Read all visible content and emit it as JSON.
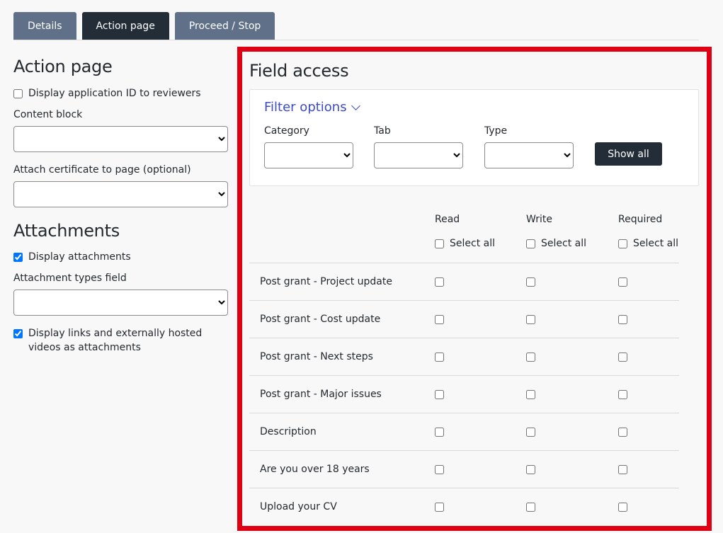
{
  "tabs": [
    {
      "label": "Details",
      "active": false
    },
    {
      "label": "Action page",
      "active": true
    },
    {
      "label": "Proceed / Stop",
      "active": false
    }
  ],
  "action_page": {
    "title": "Action page",
    "display_app_id": {
      "label": "Display application ID to reviewers",
      "checked": false
    },
    "content_block_label": "Content block",
    "certificate_label": "Attach certificate to page (optional)"
  },
  "attachments": {
    "title": "Attachments",
    "display_attachments": {
      "label": "Display attachments",
      "checked": true
    },
    "types_field_label": "Attachment types field",
    "display_links": {
      "label": "Display links and externally hosted videos as attachments",
      "checked": true
    }
  },
  "field_access": {
    "title": "Field access",
    "filter_toggle": "Filter options",
    "filters": {
      "category": "Category",
      "tab": "Tab",
      "type": "Type"
    },
    "show_all": "Show all",
    "columns": {
      "read": "Read",
      "write": "Write",
      "required": "Required"
    },
    "select_all": "Select all",
    "rows": [
      "Post grant - Project update",
      "Post grant - Cost update",
      "Post grant - Next steps",
      "Post grant - Major issues",
      "Description",
      "Are you over 18 years",
      "Upload your CV"
    ]
  },
  "colors": {
    "tab": "#5f7088",
    "tab_active": "#222d38",
    "highlight": "#e00016",
    "link": "#3b4bcc"
  }
}
